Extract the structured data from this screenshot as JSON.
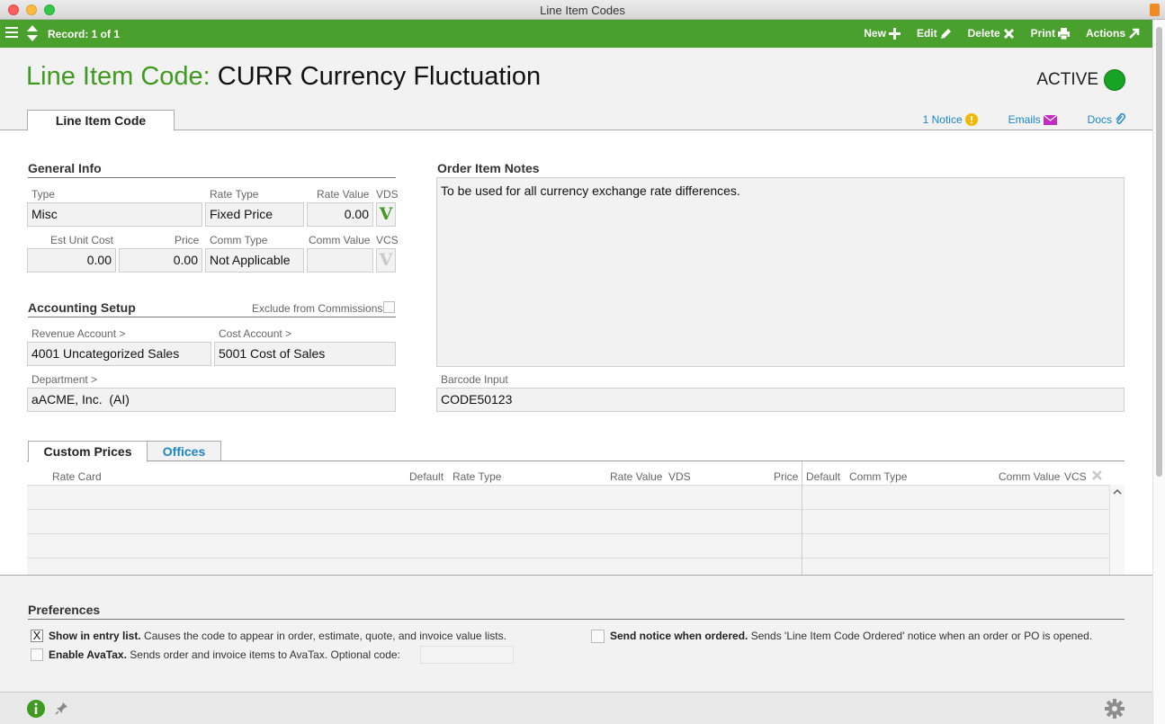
{
  "window": {
    "title": "Line Item Codes"
  },
  "toolbar": {
    "record": "Record: 1 of 1",
    "new": "New",
    "edit": "Edit",
    "delete": "Delete",
    "print": "Print",
    "actions": "Actions"
  },
  "header": {
    "label": "Line Item Code:",
    "value": "CURR Currency Fluctuation",
    "status": "ACTIVE",
    "status_color": "#17a323",
    "tab": "Line Item Code",
    "notice": "1 Notice",
    "emails": "Emails",
    "docs": "Docs"
  },
  "general": {
    "title": "General Info",
    "type_label": "Type",
    "type": "Misc",
    "rate_type_label": "Rate Type",
    "rate_type": "Fixed Price",
    "rate_value_label": "Rate Value",
    "rate_value": "0.00",
    "vds_label": "VDS",
    "vds_mark": "V",
    "est_unit_cost_label": "Est Unit Cost",
    "est_unit_cost": "0.00",
    "price_label": "Price",
    "price": "0.00",
    "comm_type_label": "Comm Type",
    "comm_type": "Not Applicable",
    "comm_value_label": "Comm Value",
    "comm_value": "",
    "vcs_label": "VCS",
    "vcs_mark": "V"
  },
  "accounting": {
    "title": "Accounting Setup",
    "exclude_label": "Exclude from Commissions",
    "revenue_label": "Revenue Account >",
    "revenue": "4001 Uncategorized Sales",
    "cost_label": "Cost Account >",
    "cost": "5001 Cost of Sales",
    "dept_label": "Department >",
    "dept": "aACME, Inc.  (AI)"
  },
  "notes": {
    "title": "Order Item Notes",
    "text": "To be used for all currency exchange rate differences.",
    "barcode_label": "Barcode Input",
    "barcode": "CODE50123"
  },
  "subtabs": {
    "custom_prices": "Custom Prices",
    "offices": "Offices"
  },
  "grid": {
    "columns": {
      "rate_card": "Rate Card",
      "default1": "Default",
      "rate_type": "Rate Type",
      "rate_value": "Rate Value",
      "vds": "VDS",
      "price": "Price",
      "default2": "Default",
      "comm_type": "Comm Type",
      "comm_value": "Comm Value",
      "vcs": "VCS"
    }
  },
  "preferences": {
    "title": "Preferences",
    "show_bold": "Show in entry list.",
    "show_text": " Causes the code to appear in order, estimate, quote, and invoice value lists.",
    "show_mark": "X",
    "avatax_bold": "Enable AvaTax.",
    "avatax_text": " Sends order and invoice items to AvaTax. Optional code:",
    "notice_bold": "Send notice when ordered.",
    "notice_text": " Sends 'Line Item Code Ordered' notice when an order or PO is opened."
  },
  "colors": {
    "brand_green": "#4aa02c",
    "title_green": "#3f9b1f",
    "link_blue": "#1a86c7"
  }
}
